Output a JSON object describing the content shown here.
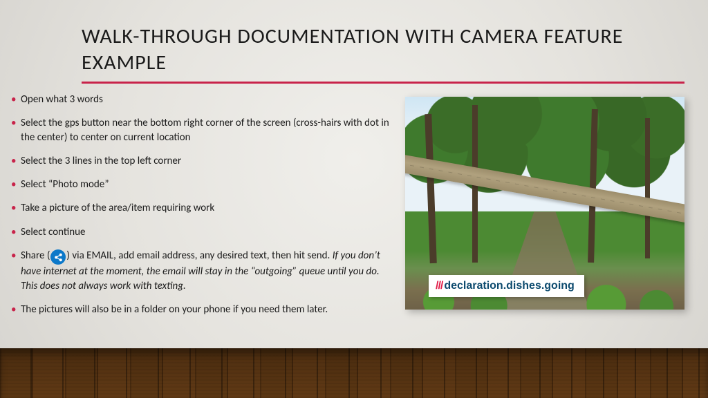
{
  "title": "WALK-THROUGH DOCUMENTATION WITH CAMERA FEATURE EXAMPLE",
  "bullets": {
    "b0": "Open what 3 words",
    "b1": "Select the gps button near the bottom right corner of the screen (cross-hairs with dot in the center) to center on current location",
    "b2": "Select the 3 lines in the top left corner",
    "b3": "Select “Photo mode”",
    "b4": "Take a picture of the area/item requiring work",
    "b5": "Select continue",
    "b6_pre": "Share (",
    "b6_post": ")  via EMAIL, add email address, any desired text, then hit send. ",
    "b6_note": "If you don’t have internet at the moment, the email will stay in the “outgoing” queue until you do. This does not always work with texting.",
    "b7": "The pictures will also be in a folder on your phone if you need them later."
  },
  "w3w": {
    "slashes": "///",
    "address": "declaration.dishes.going"
  }
}
